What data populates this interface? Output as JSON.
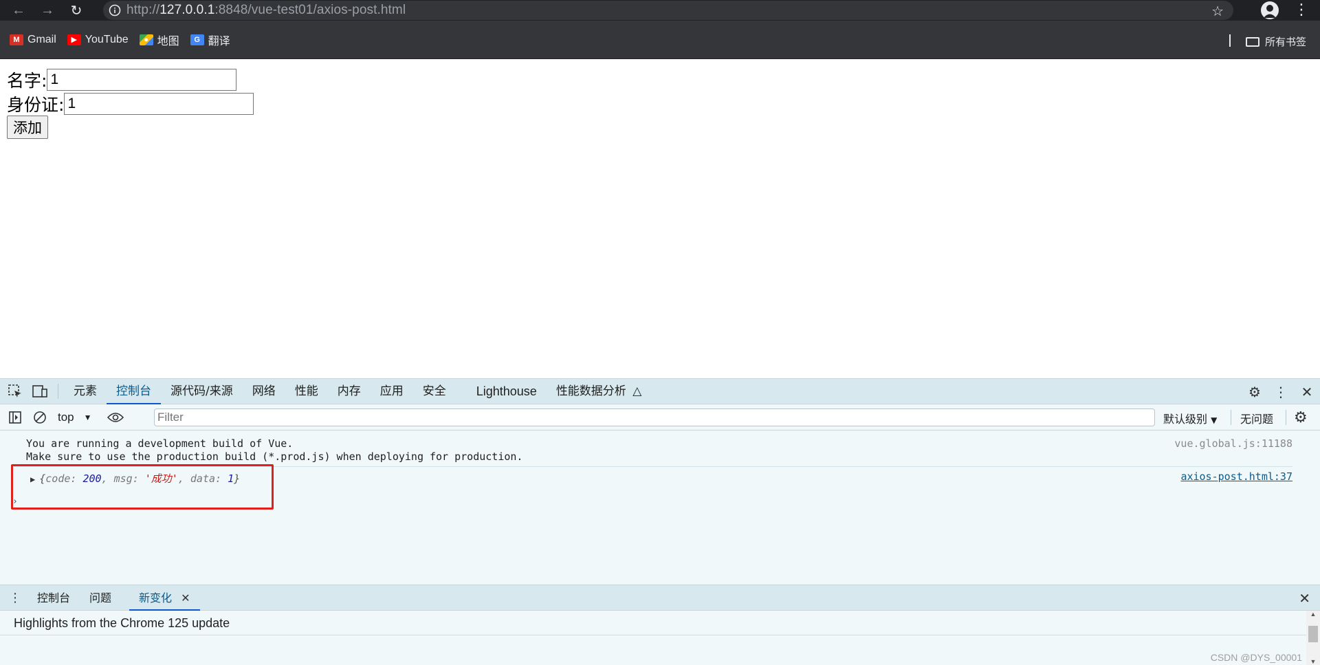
{
  "browser": {
    "url_prefix": "http://",
    "url_host": "127.0.0.1",
    "url_rest": ":8848/vue-test01/axios-post.html",
    "bookmarks": [
      {
        "label": "Gmail",
        "icon": "gmail-icon"
      },
      {
        "label": "YouTube",
        "icon": "youtube-icon"
      },
      {
        "label": "地图",
        "icon": "maps-icon"
      },
      {
        "label": "翻译",
        "icon": "translate-icon"
      }
    ],
    "all_bookmarks": "所有书签"
  },
  "page": {
    "name_label": "名字:",
    "name_value": "1",
    "id_label": "身份证:",
    "id_value": "1",
    "add_button": "添加"
  },
  "devtools": {
    "tabs": [
      "元素",
      "控制台",
      "源代码/来源",
      "网络",
      "性能",
      "内存",
      "应用",
      "安全",
      "Lighthouse",
      "性能数据分析"
    ],
    "selected_tab": "控制台",
    "context": "top",
    "filter_placeholder": "Filter",
    "level": "默认级别",
    "issues": "无问题",
    "console": {
      "msg1_line1": "You are running a development build of Vue.",
      "msg1_line2": "Make sure to use the production build (*.prod.js) when deploying for production.",
      "msg1_source": "vue.global.js:11188",
      "obj_open": "{",
      "k_code": "code: ",
      "v_code": "200",
      "k_msg": ", msg: ",
      "v_msg": "'成功'",
      "k_data": ", data: ",
      "v_data": "1",
      "obj_close": "}",
      "obj_source": "axios-post.html:37"
    },
    "drawer_tabs": [
      "控制台",
      "问题",
      "新变化"
    ],
    "drawer_selected": "新变化",
    "highlights": "Highlights from the Chrome 125 update"
  },
  "watermark": "CSDN @DYS_00001",
  "colors": {
    "highlight_box": "#e0201b",
    "devtools_bg": "#f1f8f9",
    "tab_bar_bg": "#d7e9ee"
  }
}
